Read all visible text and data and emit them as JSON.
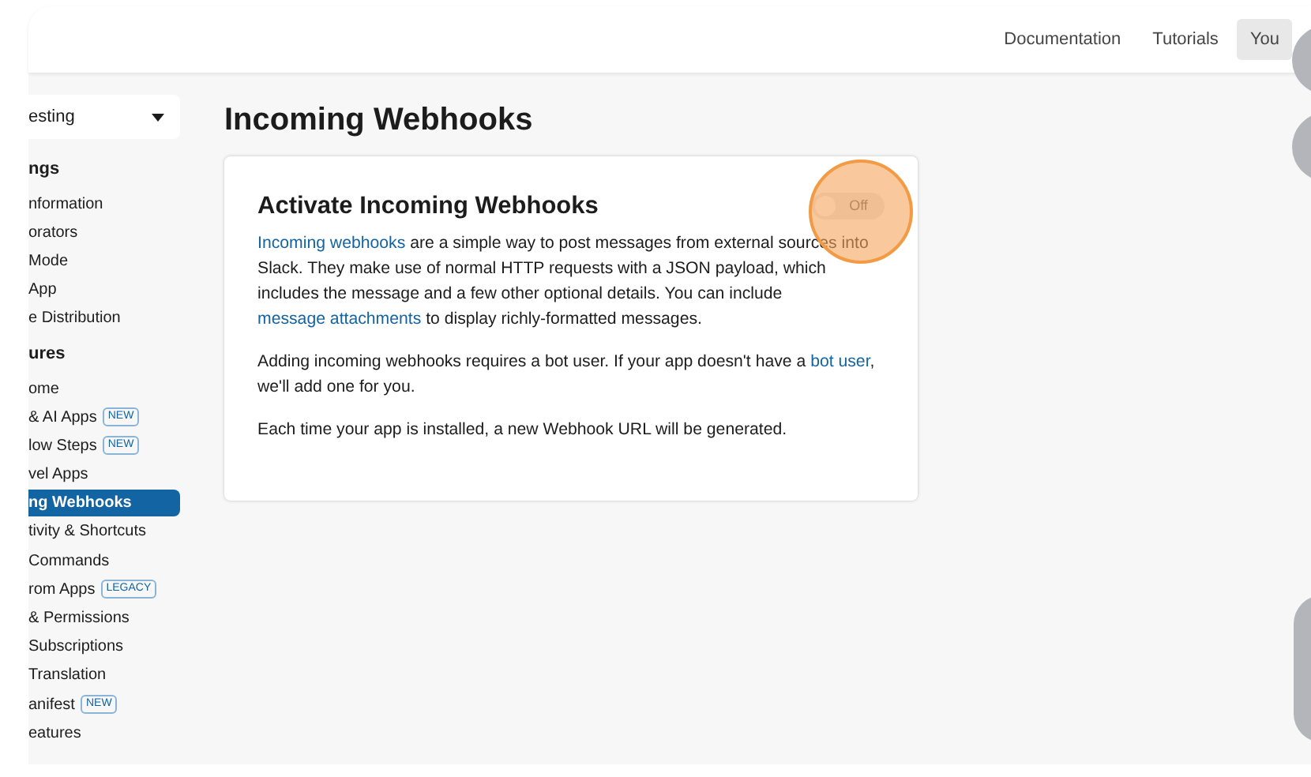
{
  "top_nav": [
    {
      "label": "Documentation",
      "selected": false
    },
    {
      "label": "Tutorials",
      "selected": false
    },
    {
      "label": "You",
      "selected": true
    }
  ],
  "app_selector": {
    "value": "esting"
  },
  "sidebar": [
    {
      "kind": "heading",
      "label": "ngs"
    },
    {
      "kind": "item",
      "label": "nformation",
      "selected": false
    },
    {
      "kind": "item",
      "label": "orators",
      "selected": false
    },
    {
      "kind": "item",
      "label": "Mode",
      "selected": false
    },
    {
      "kind": "item",
      "label": "App",
      "selected": false
    },
    {
      "kind": "item",
      "label": "e Distribution",
      "selected": false
    },
    {
      "kind": "heading",
      "label": "ures"
    },
    {
      "kind": "item",
      "label": "ome",
      "selected": false
    },
    {
      "kind": "item",
      "label": "& AI Apps",
      "selected": false,
      "badge": "NEW"
    },
    {
      "kind": "item",
      "label": "low Steps",
      "selected": false,
      "badge": "NEW"
    },
    {
      "kind": "item",
      "label": "vel Apps",
      "selected": false
    },
    {
      "kind": "item",
      "label": "ng Webhooks",
      "selected": true
    },
    {
      "kind": "item",
      "label": "tivity & Shortcuts",
      "selected": false
    },
    {
      "kind": "item",
      "label": "Commands",
      "selected": false
    },
    {
      "kind": "item",
      "label": "rom Apps",
      "selected": false,
      "badge": "LEGACY"
    },
    {
      "kind": "item",
      "label": "& Permissions",
      "selected": false
    },
    {
      "kind": "item",
      "label": "Subscriptions",
      "selected": false
    },
    {
      "kind": "item",
      "label": "Translation",
      "selected": false
    },
    {
      "kind": "item",
      "label": "anifest",
      "selected": false,
      "badge": "NEW"
    },
    {
      "kind": "item",
      "label": "eatures",
      "selected": false
    }
  ],
  "page_title": "Incoming Webhooks",
  "card": {
    "title": "Activate Incoming Webhooks",
    "toggle": {
      "on": false,
      "label": "Off"
    },
    "paragraphs": [
      [
        {
          "text": "Incoming webhooks",
          "link": true
        },
        {
          "text": " are a simple way to post messages from external sources into Slack. They make use of normal HTTP requests with a JSON payload, which includes the message and a few other optional details. You can include ",
          "link": false
        },
        {
          "text": "message attachments",
          "link": true
        },
        {
          "text": " to display richly-formatted messages.",
          "link": false
        }
      ],
      [
        {
          "text": "Adding incoming webhooks requires a bot user. If your app doesn't have a ",
          "link": false
        },
        {
          "text": "bot user",
          "link": true
        },
        {
          "text": ", we'll add one for you.",
          "link": false
        }
      ],
      [
        {
          "text": "Each time your app is installed, a new Webhook URL will be generated.",
          "link": false
        }
      ]
    ]
  }
}
